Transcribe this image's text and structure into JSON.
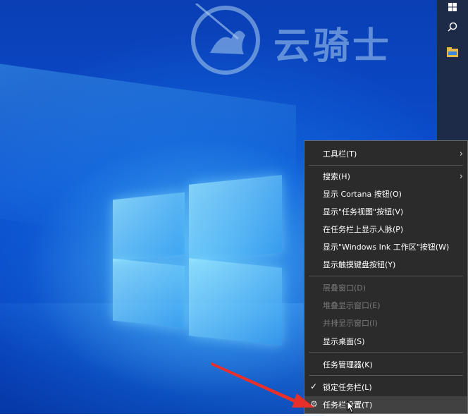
{
  "watermark": {
    "text": "云骑士"
  },
  "taskbar": {
    "icons": [
      "windows-logo-icon",
      "search-icon",
      "file-explorer-icon"
    ]
  },
  "context_menu": {
    "items": [
      {
        "label": "工具栏(T)",
        "submenu": true
      },
      {
        "label": "搜索(H)",
        "submenu": true
      },
      {
        "label": "显示 Cortana 按钮(O)"
      },
      {
        "label": "显示\"任务视图\"按钮(V)"
      },
      {
        "label": "在任务栏上显示人脉(P)"
      },
      {
        "label": "显示\"Windows Ink 工作区\"按钮(W)"
      },
      {
        "label": "显示触摸键盘按钮(Y)"
      },
      {
        "label": "层叠窗口(D)",
        "disabled": true
      },
      {
        "label": "堆叠显示窗口(E)",
        "disabled": true
      },
      {
        "label": "并排显示窗口(I)",
        "disabled": true
      },
      {
        "label": "显示桌面(S)"
      },
      {
        "label": "任务管理器(K)"
      },
      {
        "label": "锁定任务栏(L)",
        "checked": true
      },
      {
        "label": "任务栏设置(T)",
        "icon": "gear-icon",
        "hovered": true
      }
    ]
  },
  "colors": {
    "menu_bg": "#2b2b2b",
    "menu_border": "#6b6b6b",
    "taskbar_bg": "#1e2b48",
    "annotation_arrow": "#e8302a"
  }
}
